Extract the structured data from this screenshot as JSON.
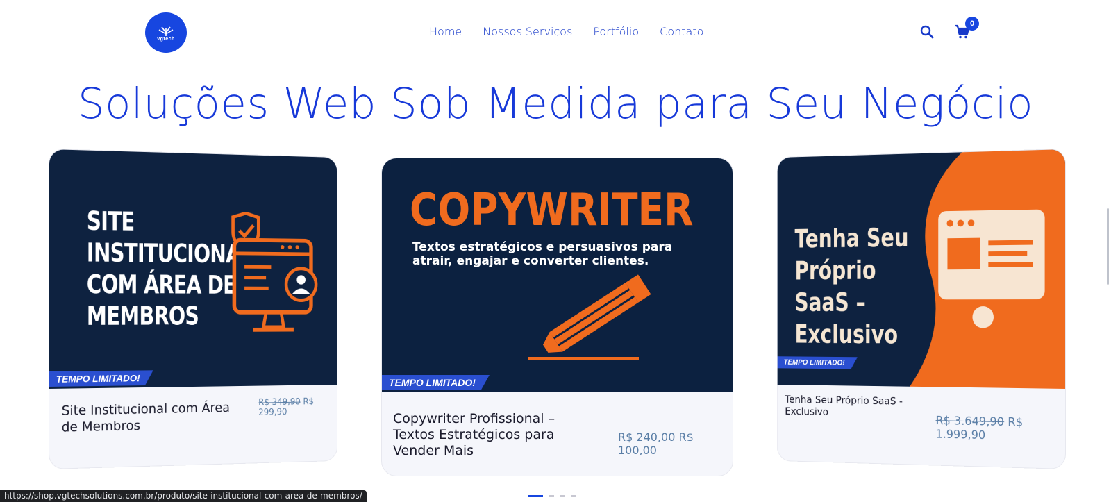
{
  "header": {
    "logo_text": "vgtech",
    "nav": [
      "Home",
      "Nossos Serviços",
      "Portfólio",
      "Contato"
    ],
    "cart_count": "0"
  },
  "headline": "Soluções Web Sob Medida para Seu Negócio",
  "cards": [
    {
      "image_lines": [
        "SITE",
        "INSTITUCIONAL",
        "COM ÁREA DE",
        "MEMBROS"
      ],
      "badge": "TEMPO LIMITADO!",
      "title": "Site Institucional com Área de Membros",
      "price_old": "R$ 349,90",
      "price_new": "R$ 299,90"
    },
    {
      "image_title": "COPYWRITER",
      "image_subtitle": "Textos estratégicos e persuasivos para atrair, engajar e converter clientes.",
      "badge": "TEMPO LIMITADO!",
      "title": "Copywriter Profissional – Textos Estratégicos para Vender Mais",
      "price_old": "R$ 240,00",
      "price_new": "R$ 100,00"
    },
    {
      "image_lines": [
        "Tenha Seu",
        "Próprio",
        "SaaS –",
        "Exclusivo"
      ],
      "badge": "TEMPO LIMITADO!",
      "title": "Tenha Seu Próprio SaaS - Exclusivo",
      "price_old": "R$ 3.649,90",
      "price_new": "R$ 1.999,90"
    }
  ],
  "carousel": {
    "active_index": 0,
    "count": 4
  },
  "status_url": "https://shop.vgtechsolutions.com.br/produto/site-institucional-com-area-de-membros/",
  "colors": {
    "brand_blue": "#1746e0",
    "navy": "#0e2240",
    "orange": "#f06b1e"
  },
  "icons": [
    "search-icon",
    "cart-icon",
    "shield-check-icon",
    "monitor-icon",
    "user-icon",
    "pencil-icon",
    "browser-window-icon"
  ]
}
